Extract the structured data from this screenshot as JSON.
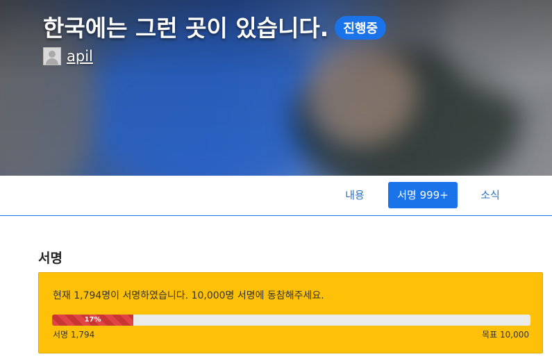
{
  "header": {
    "title": "한국에는 그런 곳이 있습니다.",
    "status": "진행중",
    "author": "apil"
  },
  "tabs": [
    {
      "label": "내용"
    },
    {
      "label": "서명 999+"
    },
    {
      "label": "소식"
    }
  ],
  "signatures": {
    "section_title": "서명",
    "message": "현재 1,794명이 서명하였습니다. 10,000명 서명에 동참해주세요.",
    "progress_fraction": 0.17,
    "progress_label": "17%",
    "count_label": "서명 1,794",
    "goal_label": "목표 10,000"
  },
  "colors": {
    "accent": "#1a73e8",
    "box": "#ffc107",
    "progress": "#e04444"
  }
}
